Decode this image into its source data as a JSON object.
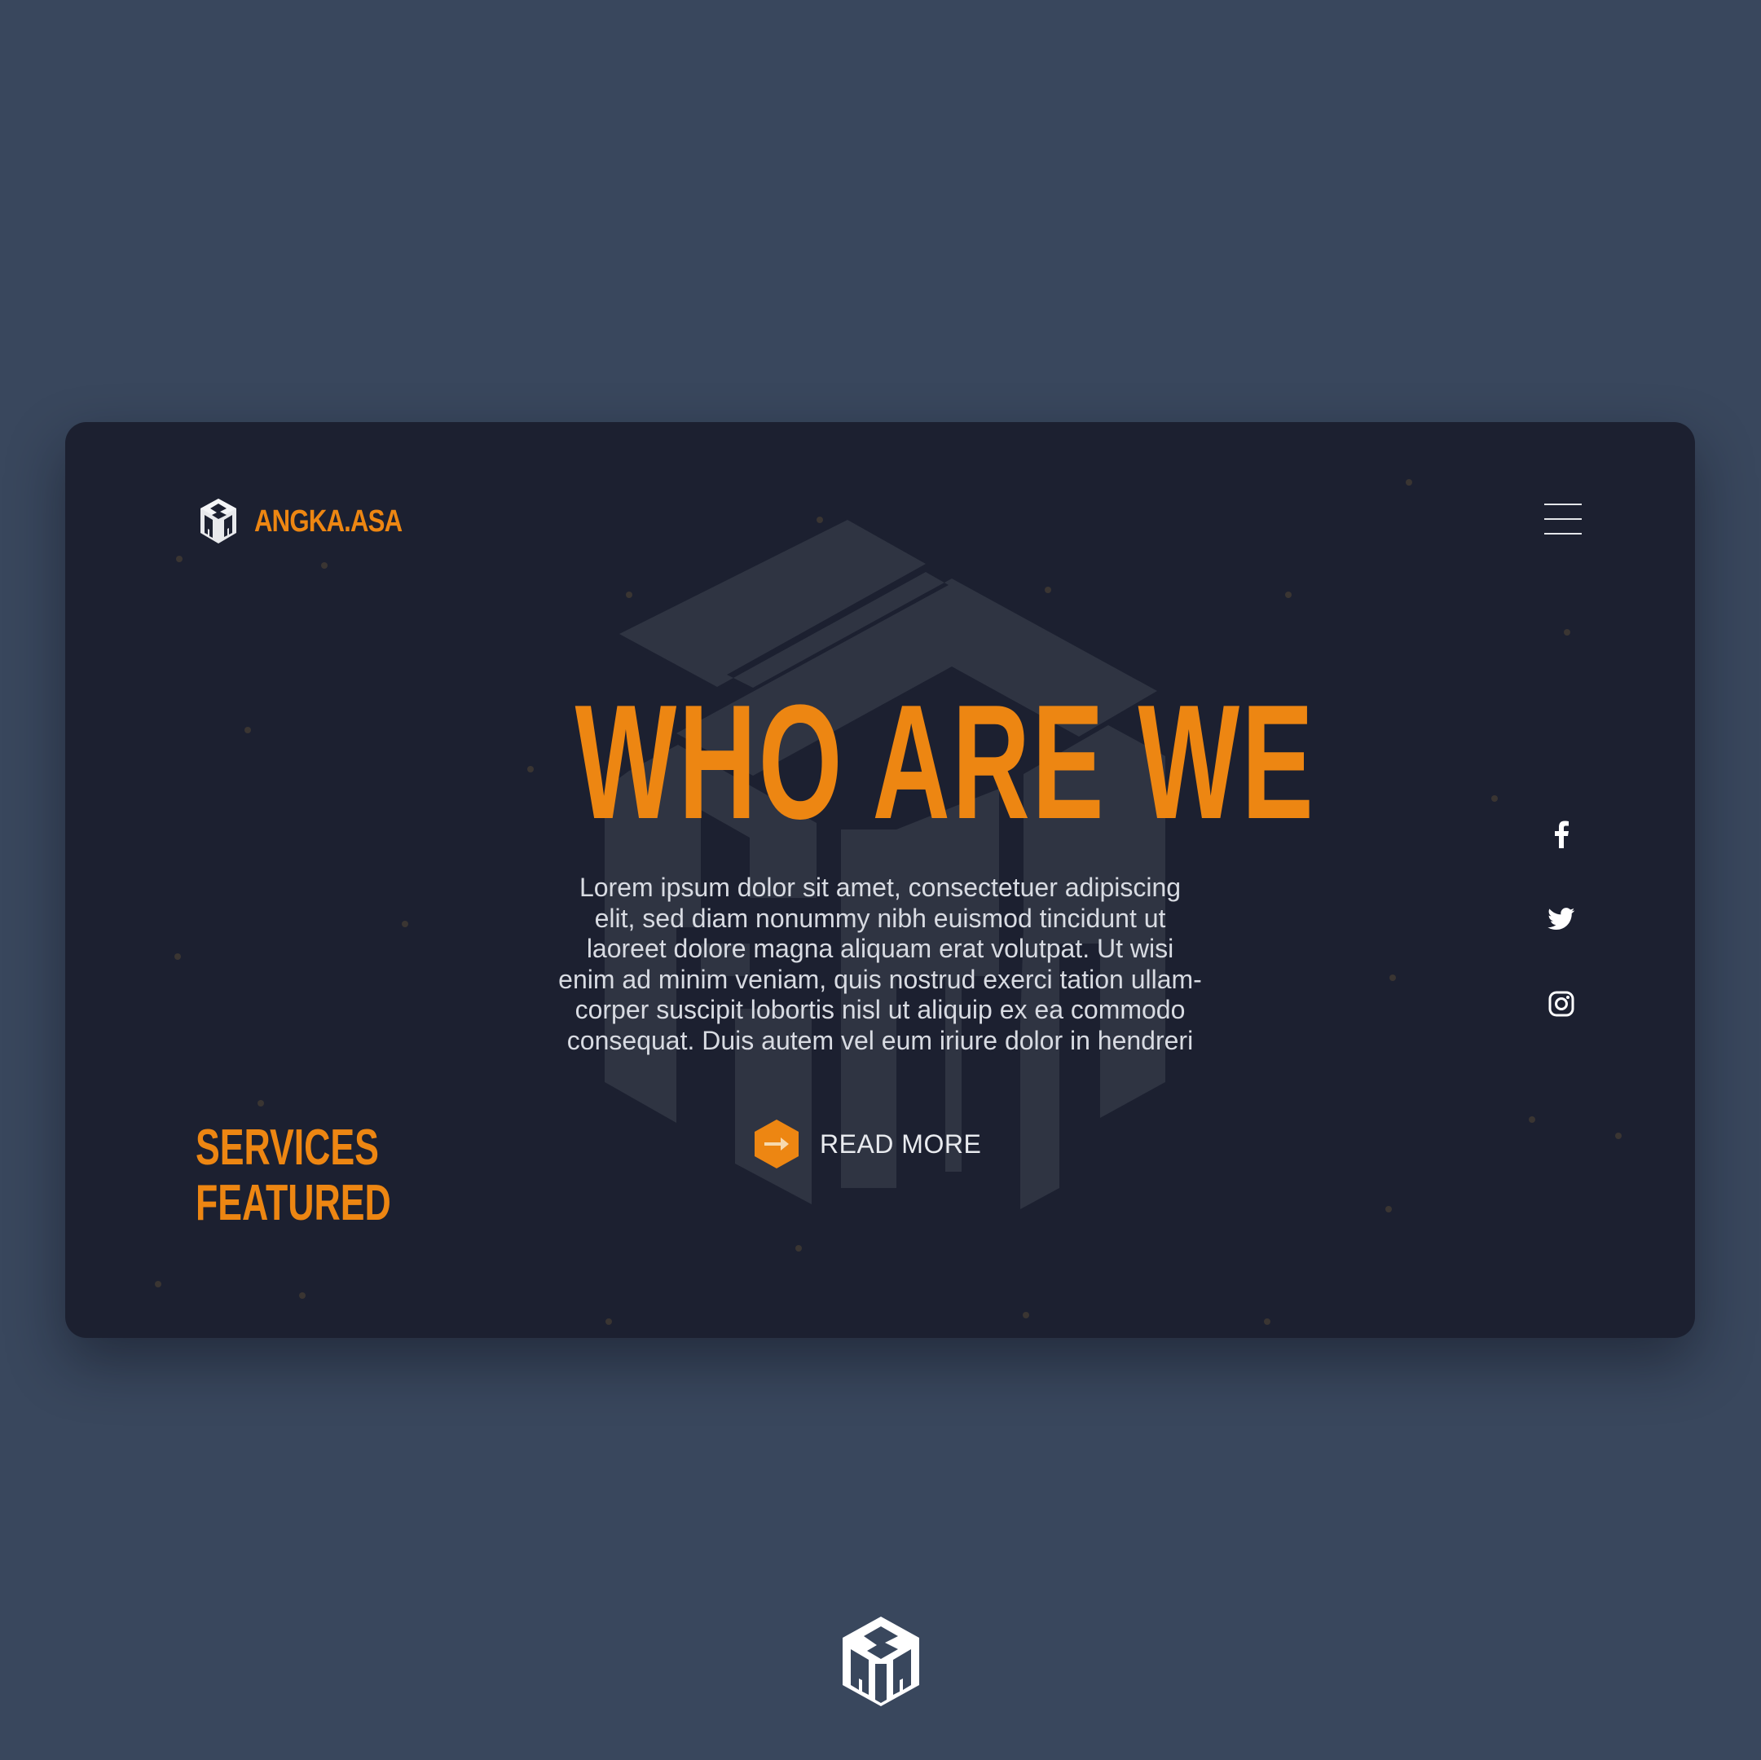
{
  "brand": {
    "name": "ANGKA.ASA",
    "logo_icon": "angka-asa-cube-logo"
  },
  "header": {
    "menu_icon": "hamburger-menu-icon"
  },
  "hero": {
    "title": "WHO ARE WE",
    "body_lines": [
      "Lorem ipsum dolor sit amet, consectetuer adipiscing",
      "elit, sed diam nonummy nibh euismod tincidunt ut",
      "laoreet dolore magna aliquam erat volutpat. Ut wisi",
      "enim ad minim veniam, quis nostrud exerci tation ullam-",
      "corper suscipit lobortis nisl ut aliquip ex ea commodo",
      "consequat. Duis autem vel eum iriure dolor in hendreri"
    ],
    "cta_label": "READ MORE",
    "cta_icon": "arrow-right-hexagon-icon"
  },
  "services": {
    "line1": "SERVICES",
    "line2": "FEATURED"
  },
  "social": [
    {
      "name": "facebook",
      "icon": "facebook-icon"
    },
    {
      "name": "twitter",
      "icon": "twitter-icon"
    },
    {
      "name": "instagram",
      "icon": "instagram-icon"
    }
  ],
  "colors": {
    "page_bg": "#39475d",
    "card_bg": "#1c2030",
    "accent": "#ed8612",
    "text": "#d8dbe2"
  }
}
